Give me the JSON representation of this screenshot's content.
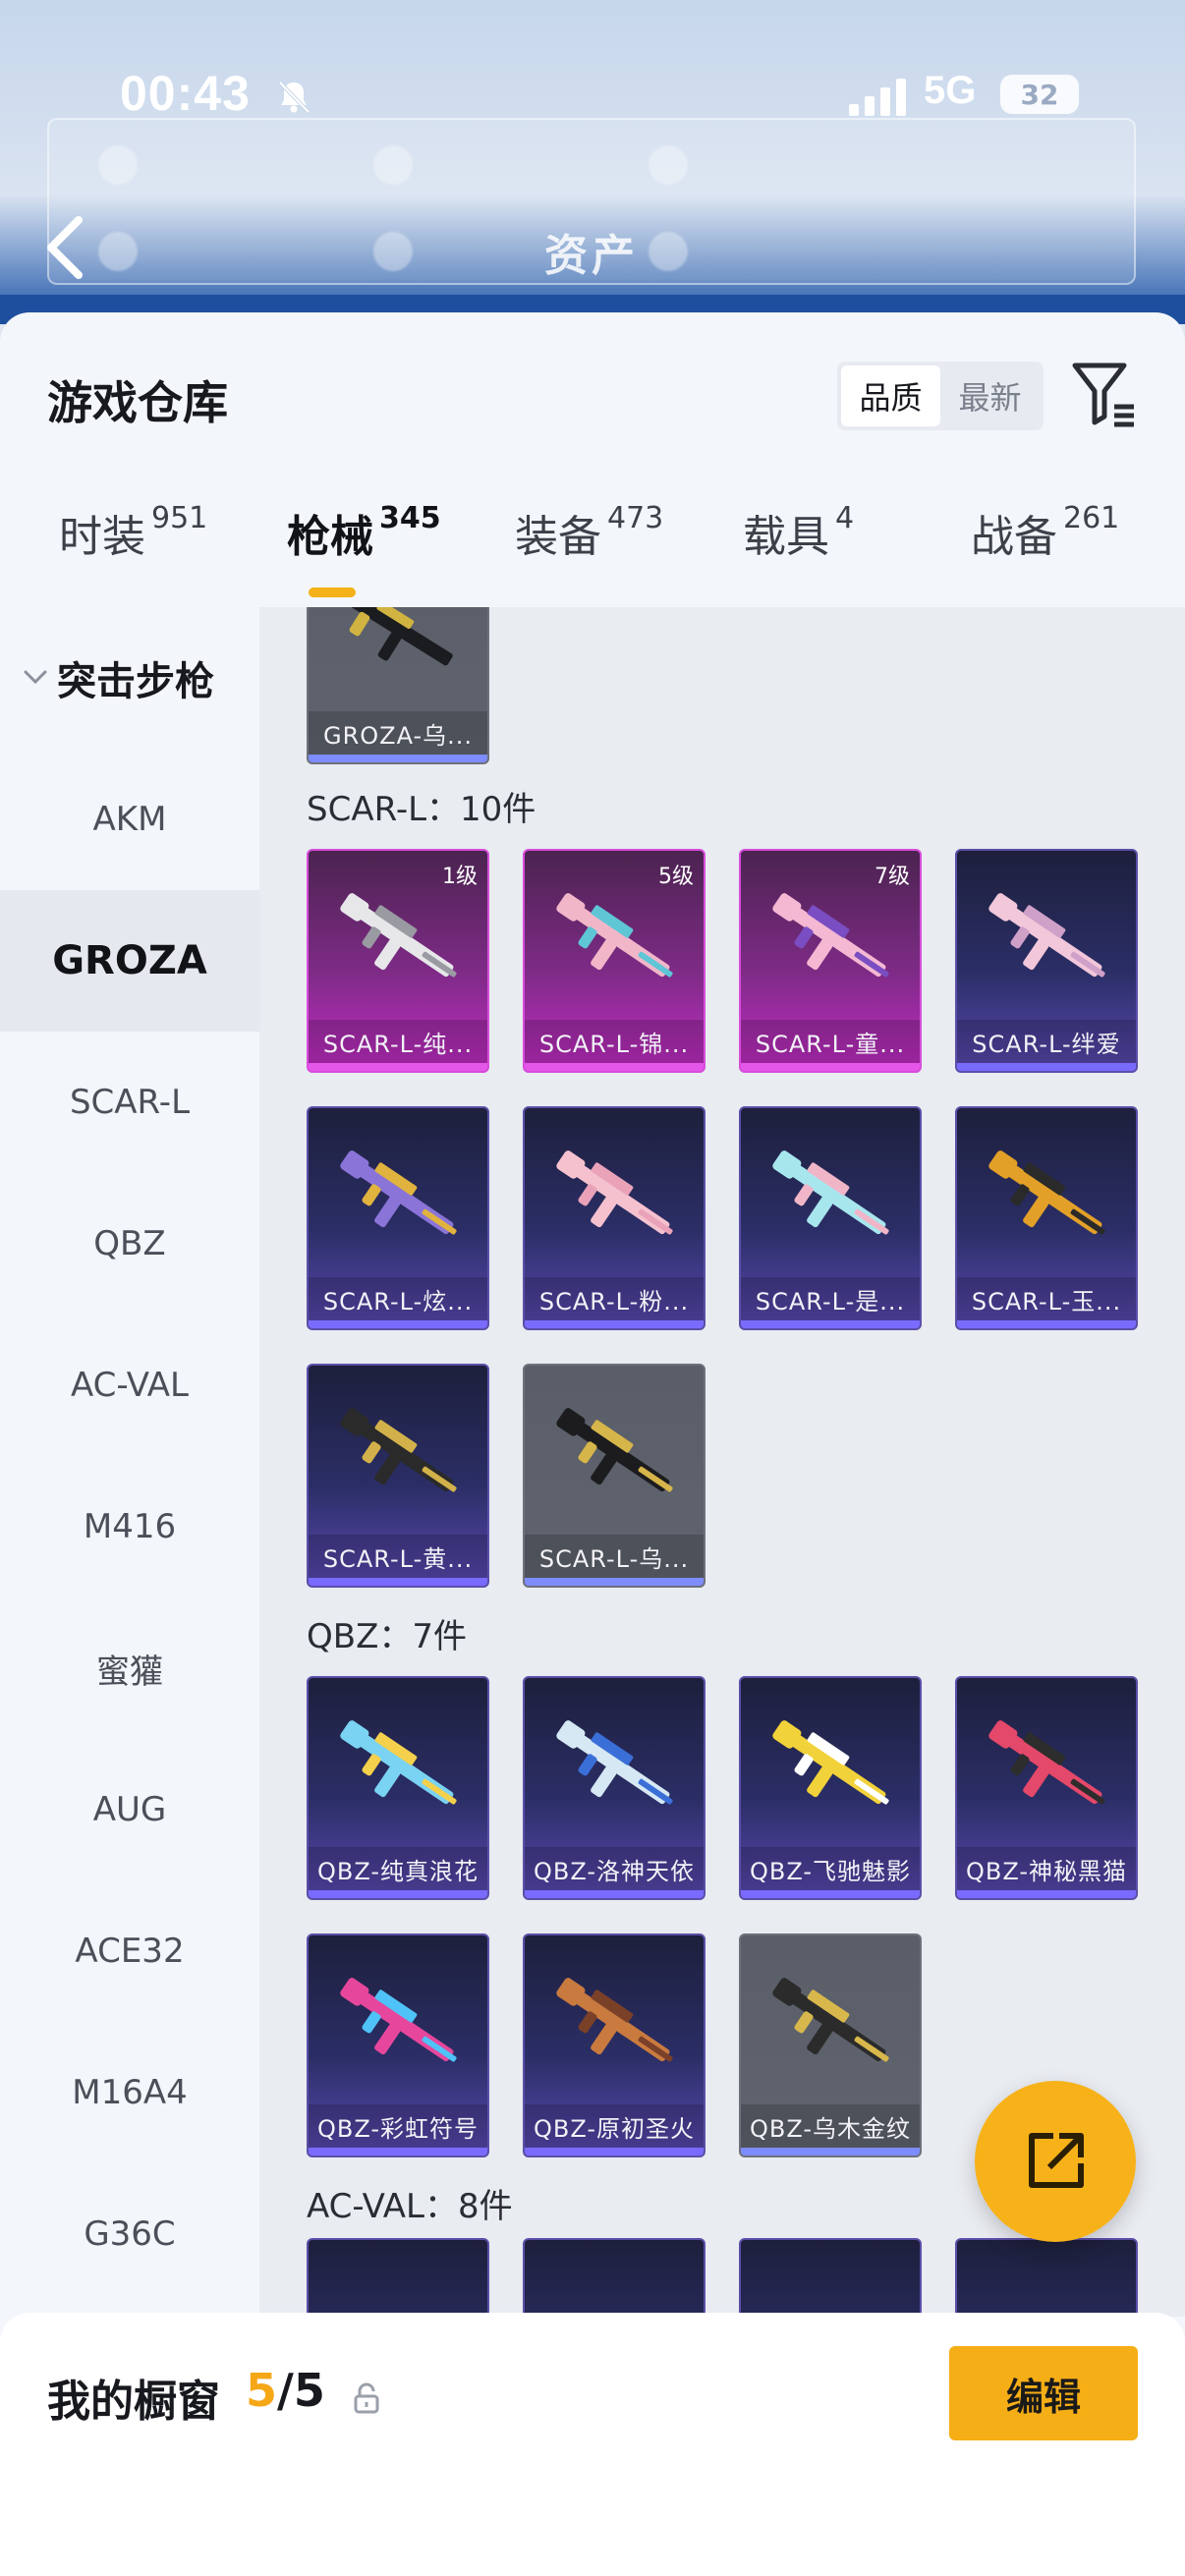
{
  "status_bar": {
    "time": "00:43",
    "network": "5G",
    "battery": "32"
  },
  "header": {
    "title": "资产"
  },
  "sheet": {
    "title": "游戏仓库",
    "sort": {
      "options": [
        "品质",
        "最新"
      ],
      "selected": "品质"
    }
  },
  "tabs": [
    {
      "label": "时装",
      "count": "951"
    },
    {
      "label": "枪械",
      "count": "345",
      "active": true
    },
    {
      "label": "装备",
      "count": "473"
    },
    {
      "label": "载具",
      "count": "4"
    },
    {
      "label": "战备",
      "count": "261"
    }
  ],
  "categories": {
    "group": "突击步枪",
    "items": [
      "AKM",
      "GROZA",
      "SCAR-L",
      "QBZ",
      "AC-VAL",
      "M416",
      "蜜獾",
      "AUG",
      "ACE32",
      "M16A4",
      "G36C"
    ],
    "selected": "GROZA"
  },
  "top_card": {
    "name": "GROZA-乌..."
  },
  "sections": [
    {
      "label": "SCAR-L：10件",
      "items": [
        {
          "name": "SCAR-L-纯...",
          "level": "1级",
          "rarity": "legend"
        },
        {
          "name": "SCAR-L-锦...",
          "level": "5级",
          "rarity": "legend"
        },
        {
          "name": "SCAR-L-童...",
          "level": "7级",
          "rarity": "legend"
        },
        {
          "name": "SCAR-L-绊爱",
          "rarity": "epic"
        },
        {
          "name": "SCAR-L-炫...",
          "rarity": "epic"
        },
        {
          "name": "SCAR-L-粉...",
          "rarity": "epic"
        },
        {
          "name": "SCAR-L-是...",
          "rarity": "epic"
        },
        {
          "name": "SCAR-L-玉...",
          "rarity": "epic"
        },
        {
          "name": "SCAR-L-黄...",
          "rarity": "epic"
        },
        {
          "name": "SCAR-L-乌...",
          "rarity": "plain"
        }
      ]
    },
    {
      "label": "QBZ：7件",
      "items": [
        {
          "name": "QBZ-纯真浪花",
          "rarity": "epic"
        },
        {
          "name": "QBZ-洛神天依",
          "rarity": "epic"
        },
        {
          "name": "QBZ-飞驰魅影",
          "rarity": "epic"
        },
        {
          "name": "QBZ-神秘黑猫",
          "rarity": "epic"
        },
        {
          "name": "QBZ-彩虹符号",
          "rarity": "epic"
        },
        {
          "name": "QBZ-原初圣火",
          "rarity": "epic"
        },
        {
          "name": "QBZ-乌木金纹",
          "rarity": "plain"
        }
      ]
    },
    {
      "label": "AC-VAL：8件"
    }
  ],
  "showcase": {
    "label": "我的橱窗",
    "used": "5",
    "total": "/5",
    "edit_label": "编辑"
  },
  "colors": {
    "accent": "#f6ae16",
    "legend": "#c32cc6",
    "epic": "#5a49b2"
  }
}
